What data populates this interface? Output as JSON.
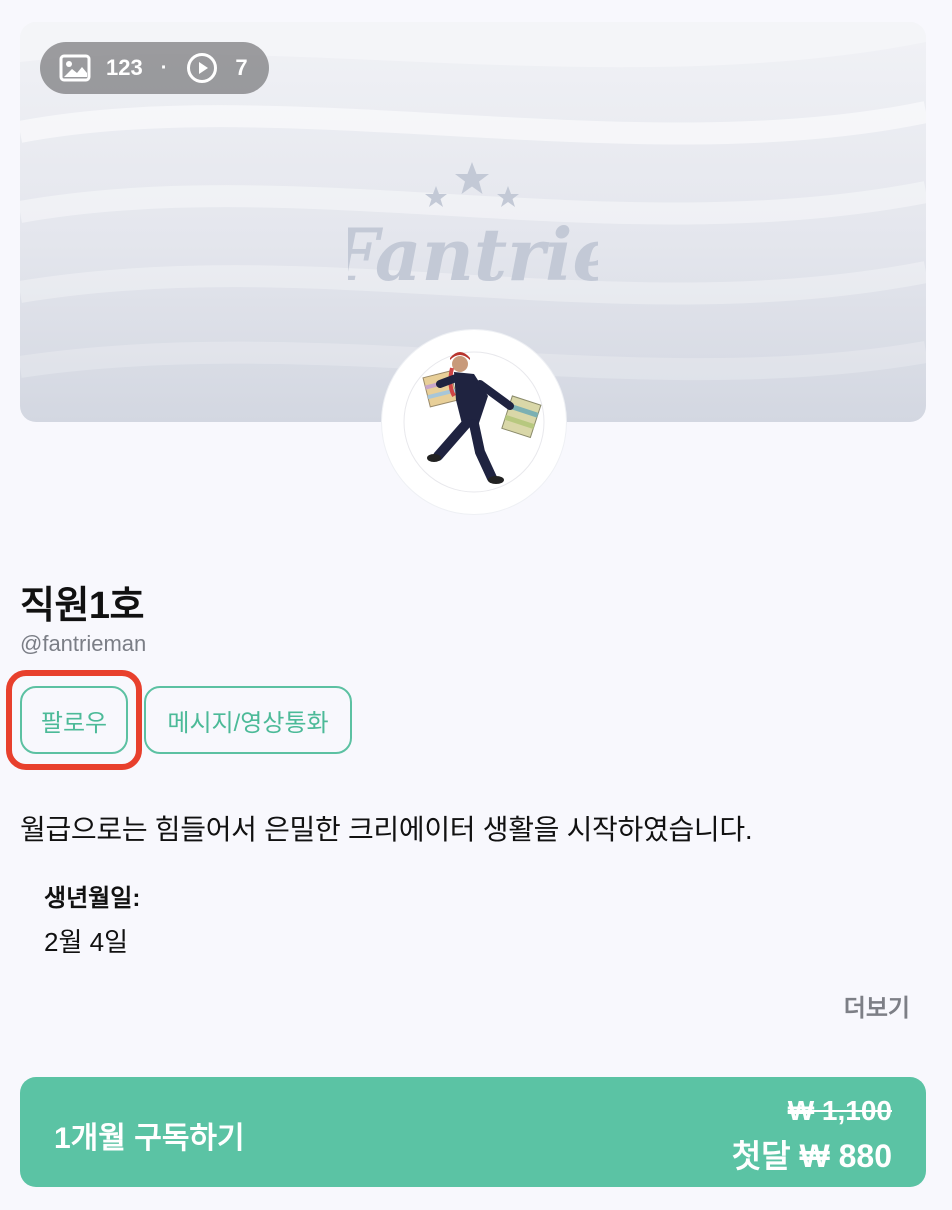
{
  "cover": {
    "photo_count": "123",
    "separator": "·",
    "video_count": "7",
    "photo_icon": "image-icon",
    "video_icon": "play-circle-icon",
    "logo_text": "Fantrie"
  },
  "profile": {
    "name": "직원1호",
    "handle": "@fantrieman"
  },
  "actions": {
    "follow_label": "팔로우",
    "message_label": "메시지/영상통화"
  },
  "bio": {
    "text": "월급으로는 힘들어서 은밀한 크리에이터 생활을 시작하였습니다.",
    "birthday_label": "생년월일:",
    "birthday_value": "2월 4일",
    "more_label": "더보기"
  },
  "subscribe": {
    "label": "1개월 구독하기",
    "original_price": "₩ 1,100",
    "first_month_price": "첫달 ₩ 880"
  },
  "colors": {
    "accent": "#5bc3a4",
    "highlight": "#e8402d",
    "background": "#f8f8fd",
    "logo": "#c3c9d6"
  }
}
